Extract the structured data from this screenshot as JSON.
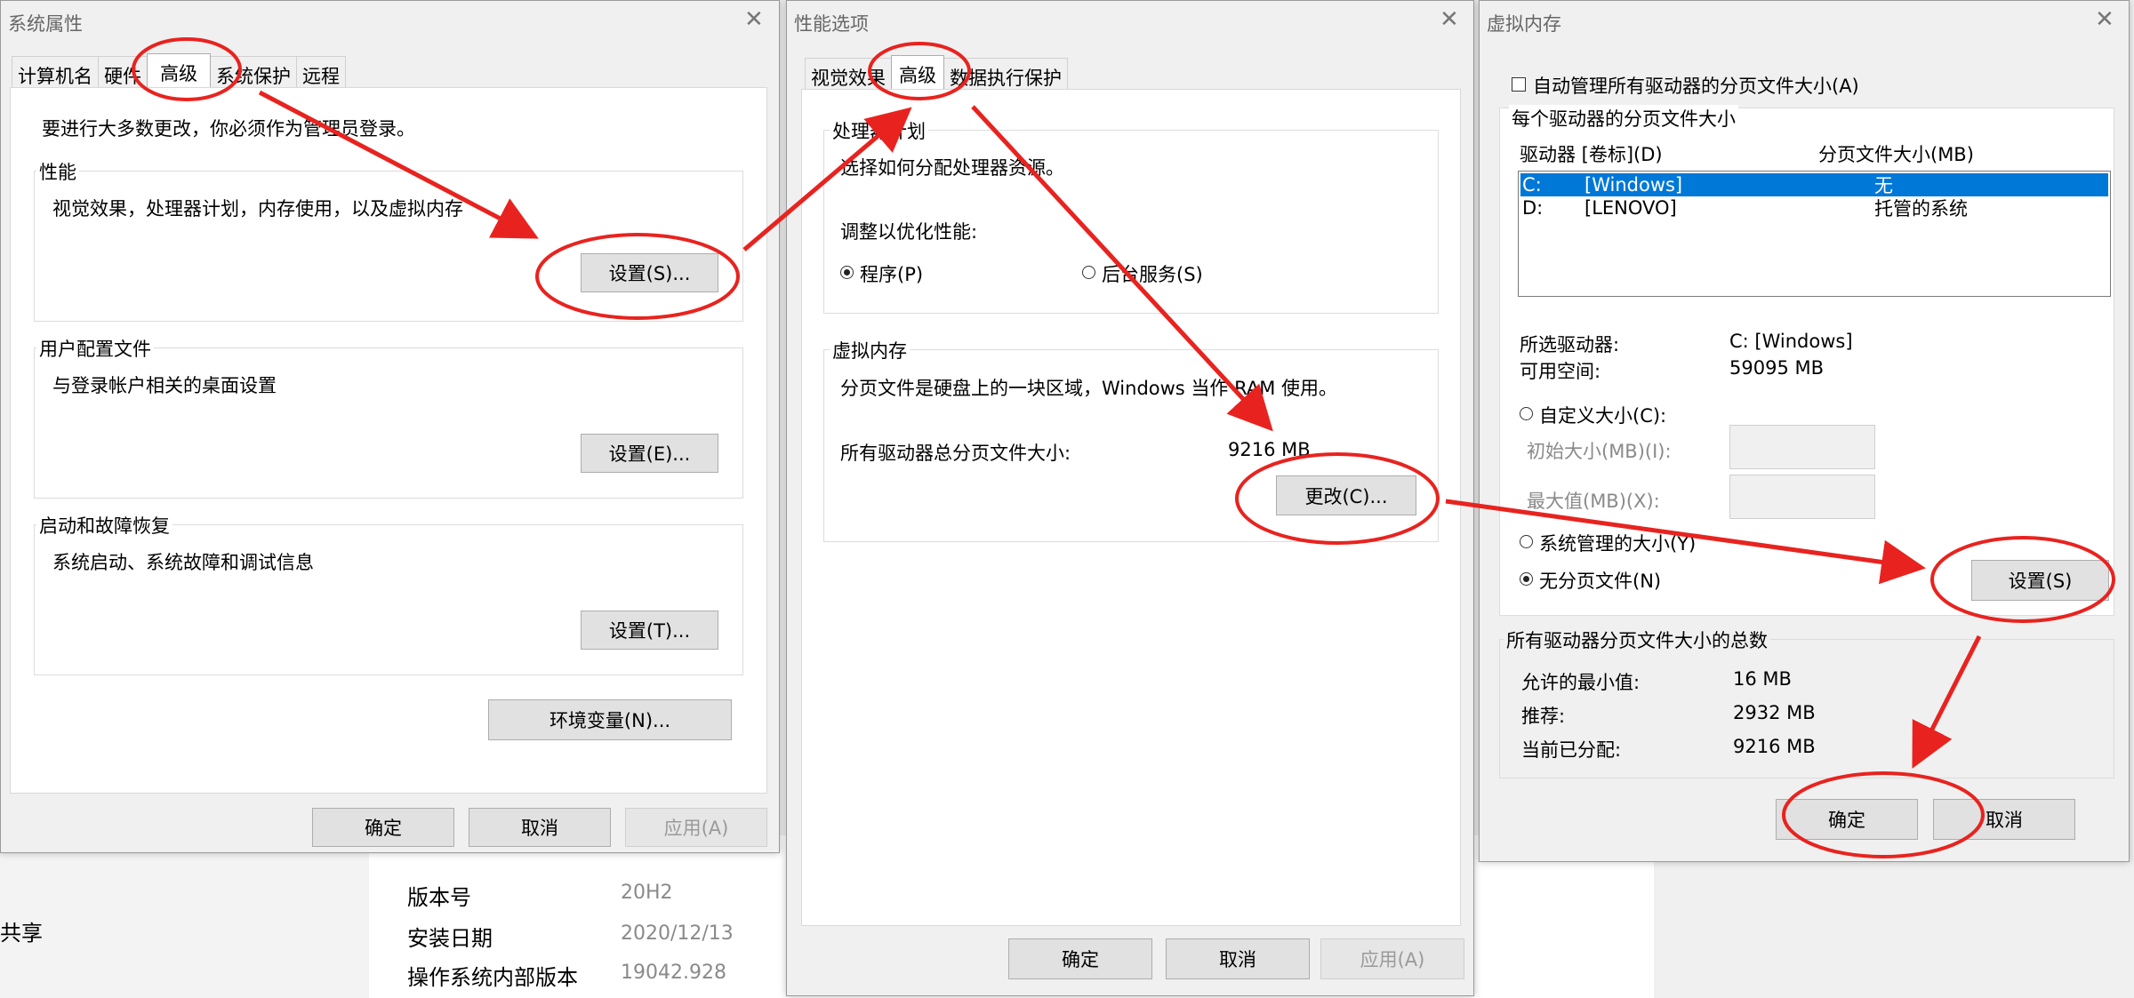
{
  "background": {
    "rows": [
      {
        "label": "版本号",
        "value": "20H2"
      },
      {
        "label": "安装日期",
        "value": "2020/12/13"
      },
      {
        "label": "操作系统内部版本",
        "value": "19042.928"
      }
    ],
    "left_fragments": [
      "共享"
    ]
  },
  "system_properties": {
    "title": "系统属性",
    "tabs": [
      "计算机名",
      "硬件",
      "高级",
      "系统保护",
      "远程"
    ],
    "active_tab": "高级",
    "admin_note": "要进行大多数更改，你必须作为管理员登录。",
    "performance": {
      "title": "性能",
      "description": "视觉效果，处理器计划，内存使用，以及虚拟内存",
      "button": "设置(S)..."
    },
    "user_profiles": {
      "title": "用户配置文件",
      "description": "与登录帐户相关的桌面设置",
      "button": "设置(E)..."
    },
    "startup_recovery": {
      "title": "启动和故障恢复",
      "description": "系统启动、系统故障和调试信息",
      "button": "设置(T)..."
    },
    "env_button": "环境变量(N)...",
    "ok": "确定",
    "cancel": "取消",
    "apply": "应用(A)"
  },
  "performance_options": {
    "title": "性能选项",
    "tabs": [
      "视觉效果",
      "高级",
      "数据执行保护"
    ],
    "active_tab": "高级",
    "processor": {
      "title": "处理器计划",
      "description": "选择如何分配处理器资源。",
      "optimize_label": "调整以优化性能:",
      "option_programs": "程序(P)",
      "option_services": "后台服务(S)"
    },
    "virtual_memory": {
      "title": "虚拟内存",
      "description": "分页文件是硬盘上的一块区域，Windows 当作 RAM 使用。",
      "total_label": "所有驱动器总分页文件大小:",
      "total_value": "9216 MB",
      "change_button": "更改(C)..."
    },
    "ok": "确定",
    "cancel": "取消",
    "apply": "应用(A)"
  },
  "virtual_memory": {
    "title": "虚拟内存",
    "auto_manage_label": "自动管理所有驱动器的分页文件大小(A)",
    "per_drive_title": "每个驱动器的分页文件大小",
    "col_drive": "驱动器 [卷标](D)",
    "col_size": "分页文件大小(MB)",
    "drives": [
      {
        "letter": "C:",
        "label": "[Windows]",
        "size": "无"
      },
      {
        "letter": "D:",
        "label": "[LENOVO]",
        "size": "托管的系统"
      }
    ],
    "selected_drive_label": "所选驱动器:",
    "selected_drive_value": "C:  [Windows]",
    "free_space_label": "可用空间:",
    "free_space_value": "59095 MB",
    "custom_size": "自定义大小(C):",
    "initial_size": "初始大小(MB)(I):",
    "max_size": "最大值(MB)(X):",
    "system_managed": "系统管理的大小(Y)",
    "no_paging": "无分页文件(N)",
    "set_button": "设置(S)",
    "totals_title": "所有驱动器分页文件大小的总数",
    "min_allowed_label": "允许的最小值:",
    "min_allowed_value": "16 MB",
    "recommended_label": "推荐:",
    "recommended_value": "2932 MB",
    "allocated_label": "当前已分配:",
    "allocated_value": "9216 MB",
    "ok": "确定",
    "cancel": "取消"
  },
  "annotation_color": "#e8231f"
}
